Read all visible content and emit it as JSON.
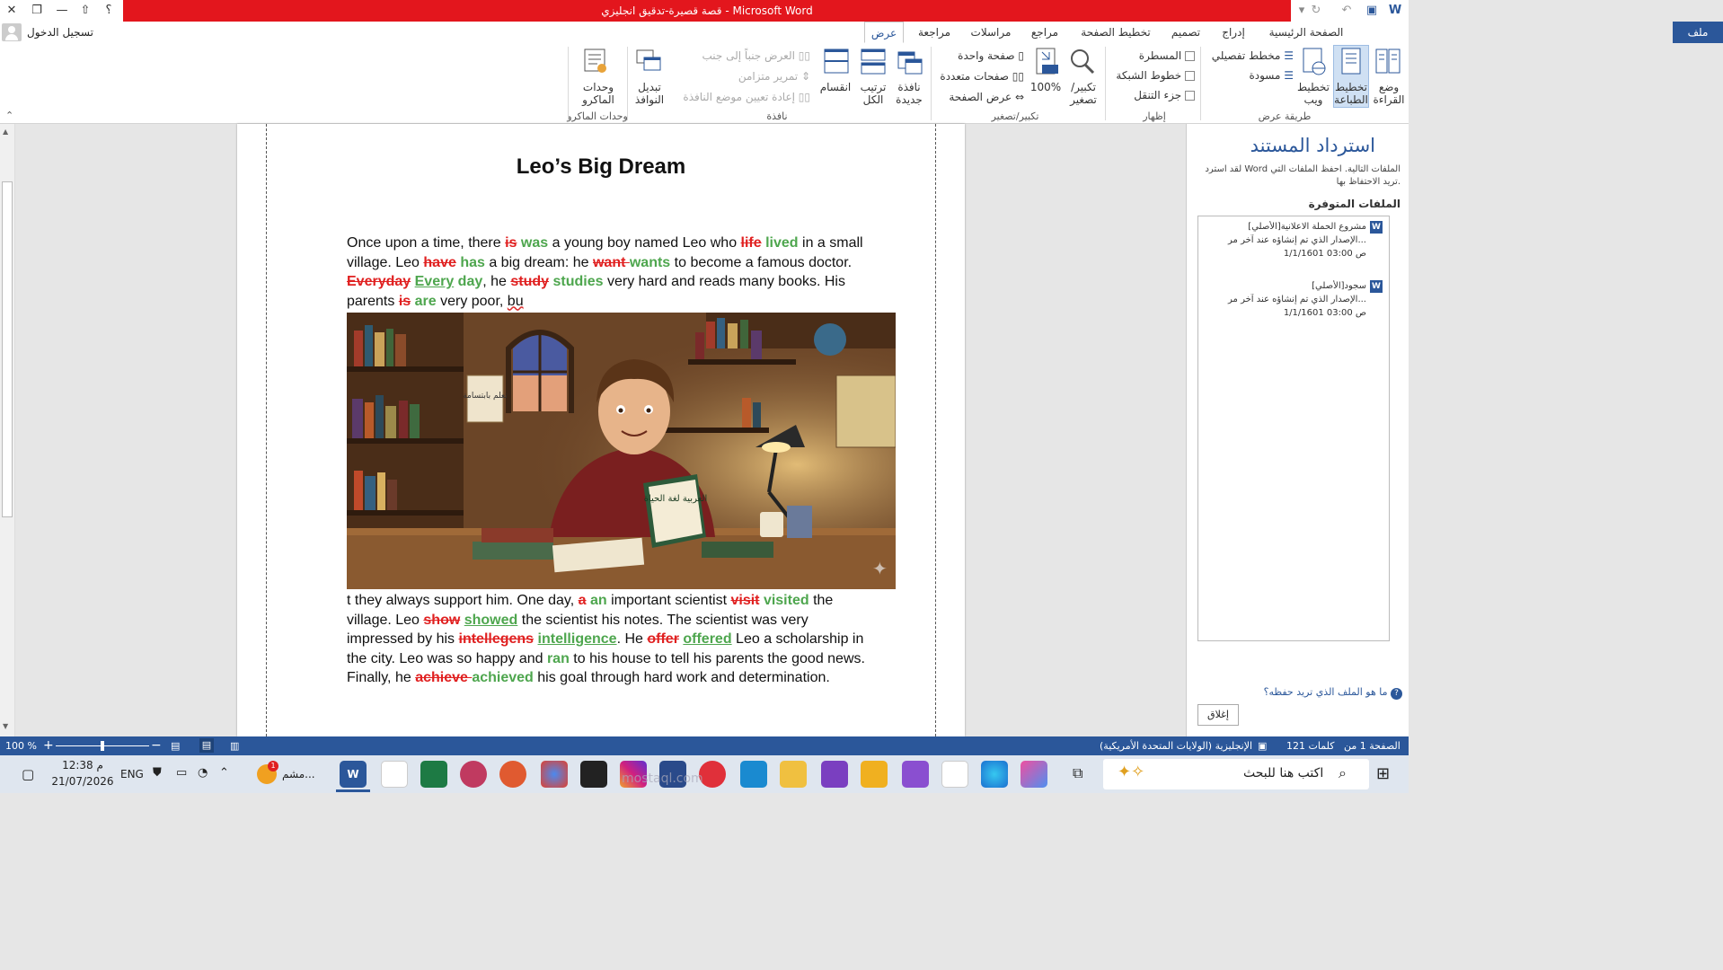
{
  "window": {
    "title": "قصة قصيرة-تدقيق انجليزي  -  Microsoft Word",
    "signin": "تسجيل الدخول",
    "help_icon": "؟"
  },
  "tabs": {
    "file": "ملف",
    "home": "الصفحة الرئيسية",
    "insert": "إدراج",
    "design": "تصميم",
    "layout": "تخطيط الصفحة",
    "references": "مراجع",
    "mailings": "مراسلات",
    "review": "مراجعة",
    "view": "عرض"
  },
  "ribbon": {
    "read_mode": "وضع القراءة",
    "print_layout": "تخطيط الطباعة",
    "web_layout": "تخطيط ويب",
    "outline": "مخطط تفصيلي",
    "draft": "مسودة",
    "views_group": "طريقة عرض",
    "ruler": "المسطرة",
    "gridlines": "خطوط الشبكة",
    "nav_pane": "جزء التنقل",
    "show_group": "إظهار",
    "zoom": "تكبير/ تصغير",
    "zoom100": "100%",
    "one_page": "صفحة واحدة",
    "multi_pages": "صفحات متعددة",
    "page_width": "عرض الصفحة",
    "zoom_group": "تكبير/تصغير",
    "new_window": "نافذة جديدة",
    "arrange_all": "ترتيب الكل",
    "split": "انقسام",
    "side_by_side": "العرض جنباً إلى جنب",
    "sync_scroll": "تمرير متزامن",
    "reset_pos": "إعادة تعيين موضع النافذة",
    "switch_windows": "تبديل النوافذ",
    "window_group": "نافذة",
    "macros": "وحدات الماكرو",
    "macros_group": "وحدات الماكرو"
  },
  "document": {
    "title": "Leo’s Big Dream",
    "p1": [
      {
        "t": "Once upon a time, there ",
        "s": "n"
      },
      {
        "t": "is",
        "s": "del"
      },
      {
        "t": " ",
        "s": "n"
      },
      {
        "t": "was",
        "s": "ins"
      },
      {
        "t": " a young boy named Leo who ",
        "s": "n"
      },
      {
        "t": "life",
        "s": "del"
      },
      {
        "t": " ",
        "s": "n"
      },
      {
        "t": "lived",
        "s": "ins"
      },
      {
        "t": " in a small village. Leo ",
        "s": "n"
      },
      {
        "t": "have",
        "s": "del"
      },
      {
        "t": " ",
        "s": "n"
      },
      {
        "t": "has",
        "s": "ins"
      },
      {
        "t": " a big dream: he ",
        "s": "n"
      },
      {
        "t": "want ",
        "s": "del"
      },
      {
        "t": "wants",
        "s": "ins"
      },
      {
        "t": " to become a famous doctor. ",
        "s": "n"
      },
      {
        "t": "Everyday",
        "s": "del"
      },
      {
        "t": " ",
        "s": "n"
      },
      {
        "t": "Every",
        "s": "insu"
      },
      {
        "t": " day",
        "s": "ins"
      },
      {
        "t": ", he ",
        "s": "n"
      },
      {
        "t": "study",
        "s": "del"
      },
      {
        "t": " ",
        "s": "n"
      },
      {
        "t": "studies",
        "s": "ins"
      },
      {
        "t": " very hard and reads many books. His parents ",
        "s": "n"
      },
      {
        "t": "is",
        "s": "del"
      },
      {
        "t": " ",
        "s": "n"
      },
      {
        "t": "are",
        "s": "ins"
      },
      {
        "t": " very poor, ",
        "s": "n"
      },
      {
        "t": "bu",
        "s": "sq"
      }
    ],
    "p2": [
      {
        "t": "t they always support him. One day, ",
        "s": "n"
      },
      {
        "t": "a",
        "s": "del"
      },
      {
        "t": " ",
        "s": "n"
      },
      {
        "t": "an",
        "s": "ins"
      },
      {
        "t": " important scientist ",
        "s": "n"
      },
      {
        "t": "visit",
        "s": "del"
      },
      {
        "t": " ",
        "s": "n"
      },
      {
        "t": "visited",
        "s": "ins"
      },
      {
        "t": " the village. Leo ",
        "s": "n"
      },
      {
        "t": "show",
        "s": "del"
      },
      {
        "t": "  ",
        "s": "n"
      },
      {
        "t": "showed",
        "s": "insu"
      },
      {
        "t": " the scientist his notes. The scientist was very impressed by his ",
        "s": "n"
      },
      {
        "t": "intellegens",
        "s": "del"
      },
      {
        "t": "  ",
        "s": "n"
      },
      {
        "t": "intelligence",
        "s": "insu"
      },
      {
        "t": ". He ",
        "s": "n"
      },
      {
        "t": "offer",
        "s": "del"
      },
      {
        "t": "  ",
        "s": "n"
      },
      {
        "t": "offered",
        "s": "insu"
      },
      {
        "t": " Leo a scholarship in the city. Leo was so happy and ",
        "s": "n"
      },
      {
        "t": "ran",
        "s": "ins"
      },
      {
        "t": " to his house to tell his parents the good news. Finally, he ",
        "s": "n"
      },
      {
        "t": "achieve ",
        "s": "del"
      },
      {
        "t": "achieved",
        "s": "ins"
      },
      {
        "t": " his goal through hard work and determination.",
        "s": "n"
      }
    ],
    "picture_book_text": "العربية لغة الحياة",
    "picture_sign_text": "تعلم بابتسامة"
  },
  "recovery": {
    "title": "استرداد المستند",
    "desc": "لقد استرد Word الملفات التالية. احفظ الملفات التي تريد الاحتفاظ بها.",
    "available": "الملفات المتوفرة",
    "files": [
      {
        "name": "[الأصلي]مشروع الحملة الاعلانية",
        "line2": "الإصدار الذي تم إنشاؤه عند آخر مر...",
        "line3": "1/1/1601 03:00 ص"
      },
      {
        "name": "[الأصلي]سجود",
        "line2": "الإصدار الذي تم إنشاؤه عند آخر مر...",
        "line3": "1/1/1601 03:00 ص"
      }
    ],
    "which_file": "ما هو الملف الذي تريد حفظه؟",
    "close": "إغلاق"
  },
  "status": {
    "page": "الصفحة 1 من 1",
    "words": "121 كلمات",
    "lang": "الإنجليزية (الولايات المتحدة الأمريكية)",
    "zoom": "100 %"
  },
  "taskbar": {
    "search": "اكتب هنا للبحث",
    "time": "12:38 م",
    "date": "21/07/2026",
    "lang": "ENG",
    "app_label": "مشم...",
    "badge": "1",
    "watermark": "mostaql.com"
  },
  "colors": {
    "word_blue": "#2b579a",
    "title_red": "#e3161d",
    "deleted": "#e02020",
    "inserted": "#4ea64e"
  }
}
